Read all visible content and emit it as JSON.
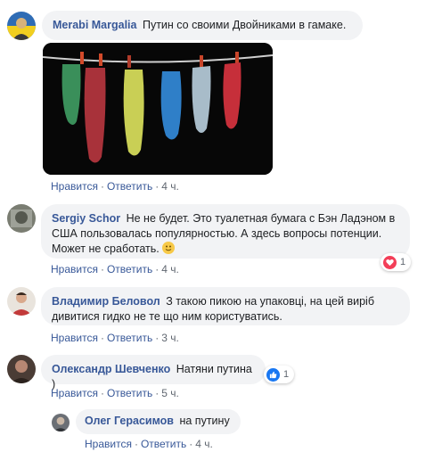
{
  "comments": [
    {
      "author": "Merabi Margalia",
      "text": "Путин со своими Двойниками в гамаке.",
      "like_label": "Нравится",
      "reply_label": "Ответить",
      "time": "4 ч."
    },
    {
      "author": "Sergiy Schor",
      "text": "Не не будет. Это туалетная бумага с Бэн Ладэном в США пользовалась популярностью. А здесь вопросы потенции. Может не сработать.",
      "emoji": "slightly-smiling-face-emoji",
      "like_label": "Нравится",
      "reply_label": "Ответить",
      "time": "4 ч.",
      "reaction": {
        "type": "love",
        "count": "1",
        "color": "#f33e58"
      }
    },
    {
      "author": "Владимир Беловол",
      "text": "З такою пикою на упаковці, на цей виріб дивитися гидко не те що ним користуватись.",
      "like_label": "Нравится",
      "reply_label": "Ответить",
      "time": "3 ч."
    },
    {
      "author": "Олександр Шевченко",
      "text": "Натяни путина )",
      "like_label": "Нравится",
      "reply_label": "Ответить",
      "time": "5 ч.",
      "reaction": {
        "type": "like",
        "count": "1",
        "color": "#1877f2"
      }
    },
    {
      "author": "Олег Герасимов",
      "text": "на путину",
      "like_label": "Нравится",
      "reply_label": "Ответить",
      "time": "4 ч."
    }
  ],
  "colors": {
    "link": "#385898",
    "bubble": "#f2f3f5",
    "meta": "#606770"
  },
  "icons": [
    "heart-icon",
    "thumbs-up-icon",
    "slightly-smiling-face-emoji"
  ]
}
